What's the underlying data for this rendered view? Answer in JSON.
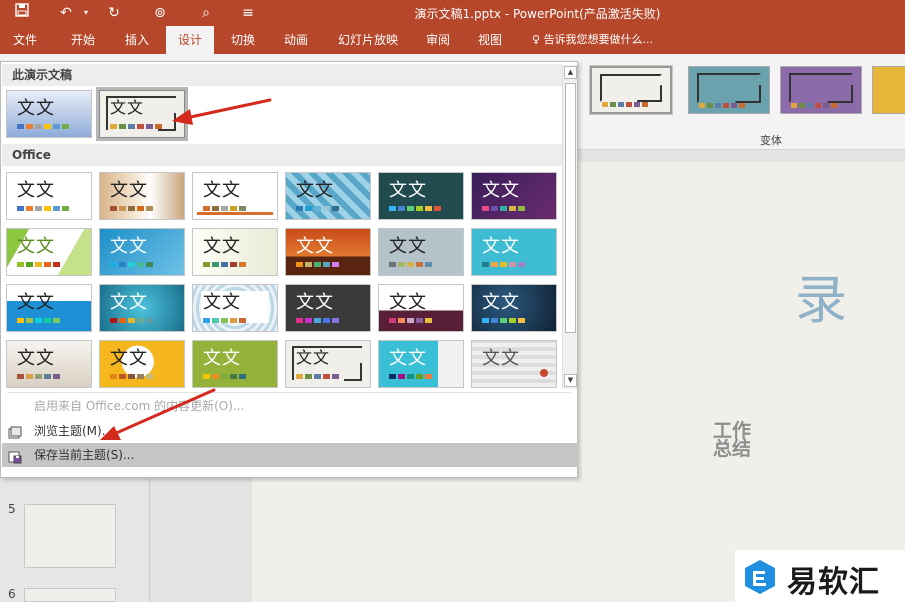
{
  "window": {
    "title": "演示文稿1.pptx - PowerPoint(产品激活失败)"
  },
  "tabs": [
    {
      "label": "文件"
    },
    {
      "label": "开始"
    },
    {
      "label": "插入"
    },
    {
      "label": "设计"
    },
    {
      "label": "切换"
    },
    {
      "label": "动画"
    },
    {
      "label": "幻灯片放映"
    },
    {
      "label": "审阅"
    },
    {
      "label": "视图"
    }
  ],
  "active_tab": "设计",
  "tell_me": "告诉我您想要做什么...",
  "ribbon": {
    "variant_label": "变体"
  },
  "panel": {
    "section_this": "此演示文稿",
    "section_office": "Office",
    "theme_text": "文文",
    "menu": {
      "enable_updates": "启用来自 Office.com 的内容更新(O)...",
      "browse": "浏览主题(M)...",
      "save": "保存当前主题(S)..."
    }
  },
  "slides": {
    "num5": "5",
    "num6": "6"
  },
  "slide_content": {
    "big_char": "录",
    "subtitle": "工作总结"
  },
  "watermark": {
    "text": "易软汇"
  },
  "colors": {
    "accent": "#b7472a",
    "brand_blue": "#1e8fe1"
  }
}
